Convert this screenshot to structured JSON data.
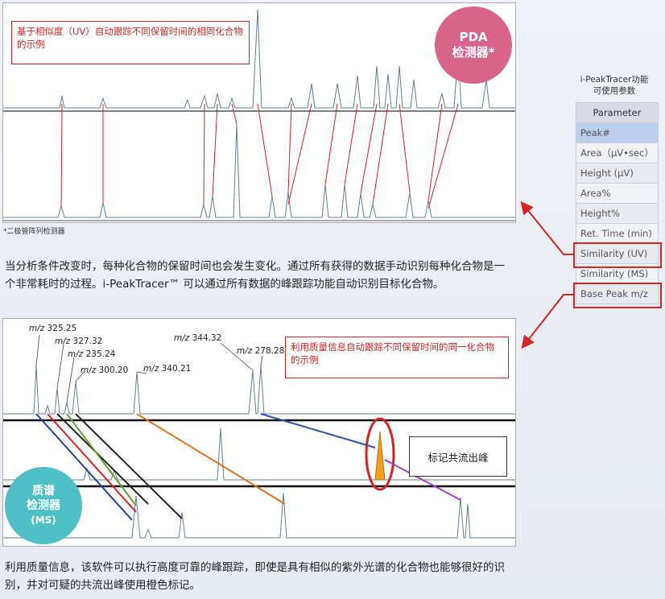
{
  "pda_panel": {
    "annotation": "基于相似度（UV）自动跟踪不同保留时间的相同化合物的示例",
    "badge_line1": "PDA",
    "badge_line2": "检测器*",
    "footnote": "*二极管阵列检测器"
  },
  "paragraph1": "当分析条件改变时，每种化合物的保留时间也会发生变化。通过所有获得的数据手动识别每种化合物是一个非常耗时的过程。i-PeakTracer™ 可以通过所有数据的峰跟踪功能自动识别目标化合物。",
  "ms_panel": {
    "annotation": "利用质量信息自动跟踪不同保留时间的同一化合物的示例",
    "coelution_label": "标记共流出峰",
    "badge_line1": "质谱",
    "badge_line2": "检测器",
    "badge_line3": "(MS)",
    "mz_labels": [
      {
        "prefix": "m/z",
        "value": "325.25"
      },
      {
        "prefix": "m/z",
        "value": "327.32"
      },
      {
        "prefix": "m/z",
        "value": "235.24"
      },
      {
        "prefix": "m/z",
        "value": "300.20"
      },
      {
        "prefix": "m/z",
        "value": "340.21"
      },
      {
        "prefix": "m/z",
        "value": "344.32"
      },
      {
        "prefix": "m/z",
        "value": "278.28"
      }
    ]
  },
  "paragraph2": "利用质量信息，该软件可以执行高度可靠的峰跟踪，即使是具有相似的紫外光谱的化合物也能够很好的识别，并对可疑的共流出峰使用橙色标记。",
  "params": {
    "title_line1": "i-PeakTracer功能",
    "title_line2": "可使用参数",
    "header": "Parameter",
    "rows": [
      "Peak#",
      "Area（µV•sec）",
      "Height (µV)",
      "Area%",
      "Height%",
      "Ret. Time (min)",
      "Similarity (UV)",
      "Similarity (MS)",
      "Base Peak m/z"
    ]
  },
  "colors": {
    "accent_red": "#d42424",
    "pda_badge": "#d9648a",
    "ms_badge": "#4fbfc6",
    "coelution": "#f0a020"
  }
}
